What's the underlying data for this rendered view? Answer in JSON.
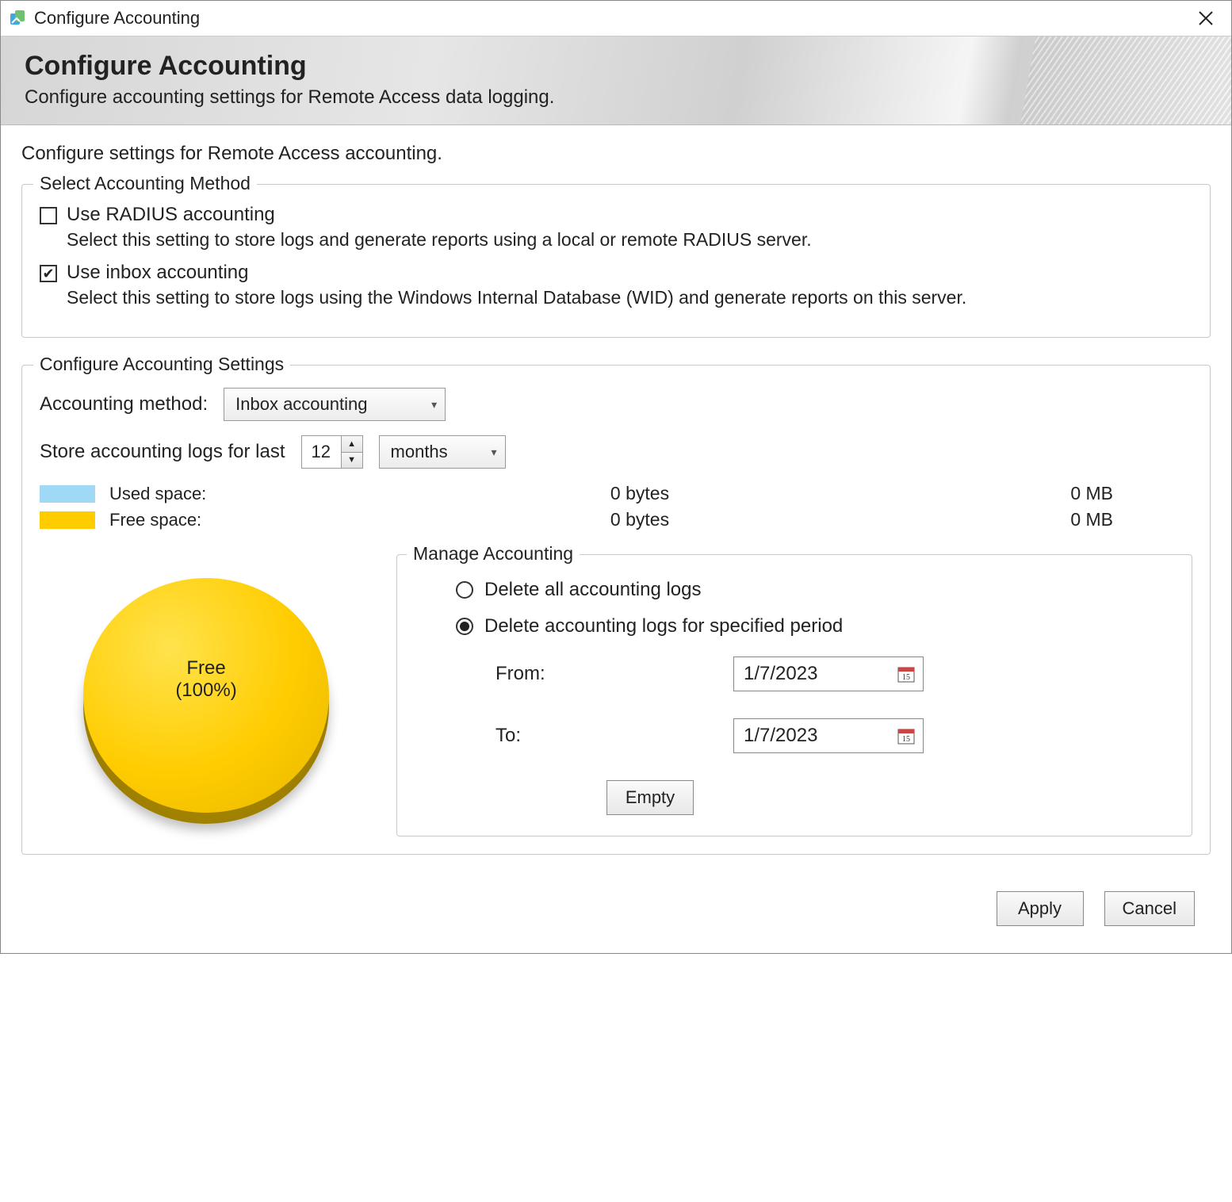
{
  "titlebar": {
    "title": "Configure Accounting"
  },
  "header": {
    "title": "Configure Accounting",
    "subtitle": "Configure accounting settings for Remote Access data logging."
  },
  "intro": "Configure settings for Remote Access accounting.",
  "method_group": {
    "legend": "Select Accounting Method",
    "radius": {
      "label": "Use RADIUS accounting",
      "checked": false,
      "desc": "Select this setting to store logs and generate reports using a local or remote RADIUS server."
    },
    "inbox": {
      "label": "Use inbox accounting",
      "checked": true,
      "desc": "Select this setting to store logs using the Windows Internal Database (WID) and generate reports on this server."
    }
  },
  "settings_group": {
    "legend": "Configure Accounting Settings",
    "method_label": "Accounting method:",
    "method_value": "Inbox accounting",
    "store_label": "Store accounting logs for last",
    "store_value": "12",
    "store_unit": "months",
    "used_label": "Used space:",
    "free_label": "Free space:",
    "used_bytes": "0 bytes",
    "free_bytes": "0 bytes",
    "used_mb": "0 MB",
    "free_mb": "0 MB",
    "pie_label_line1": "Free",
    "pie_label_line2": "(100%)"
  },
  "manage_group": {
    "legend": "Manage Accounting",
    "opt_all": "Delete all accounting logs",
    "opt_period": "Delete accounting logs for specified period",
    "selected": "period",
    "from_label": "From:",
    "to_label": "To:",
    "from_value": "1/7/2023",
    "to_value": "1/7/2023",
    "empty_btn": "Empty"
  },
  "footer": {
    "apply": "Apply",
    "cancel": "Cancel"
  },
  "chart_data": {
    "type": "pie",
    "title": "Disk usage",
    "series": [
      {
        "name": "Free",
        "value": 100,
        "color": "#ffcc00"
      },
      {
        "name": "Used",
        "value": 0,
        "color": "#9fd9f6"
      }
    ],
    "label": "Free (100%)"
  }
}
